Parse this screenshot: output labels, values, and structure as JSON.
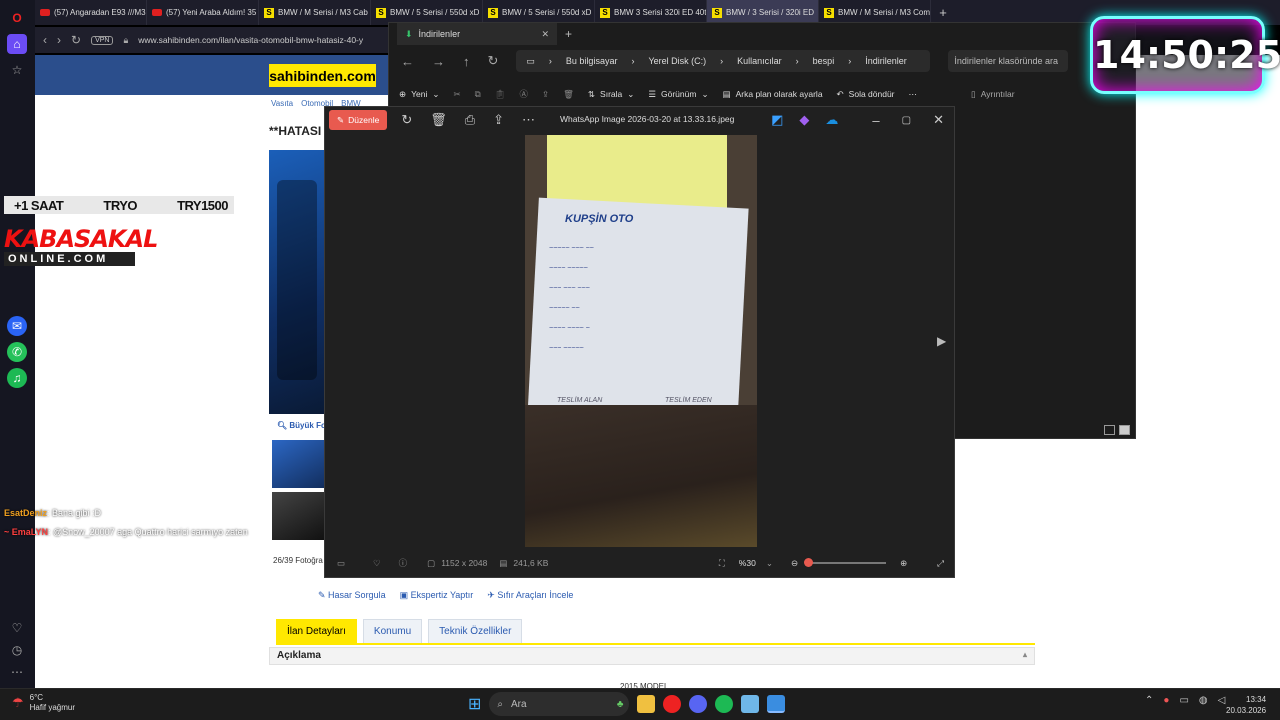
{
  "browser": {
    "tabs": [
      {
        "icon": "youtube-icon",
        "label": "(57) Angaradan E93 ///M3"
      },
      {
        "icon": "youtube-icon",
        "label": "(57) Yeni Araba Aldım! 35"
      },
      {
        "icon": "sahibinden-icon",
        "label": "BMW / M Serisi / M3 Cab"
      },
      {
        "icon": "sahibinden-icon",
        "label": "BMW / 5 Serisi / 550d xD"
      },
      {
        "icon": "sahibinden-icon",
        "label": "BMW / 5 Serisi / 550d xD"
      },
      {
        "icon": "sahibinden-icon",
        "label": "BMW 3 Serisi 320i ED 40th"
      },
      {
        "icon": "sahibinden-icon",
        "label": "BMW / 3 Serisi / 320i ED"
      },
      {
        "icon": "sahibinden-icon",
        "label": "BMW / M Serisi / M3 Com"
      }
    ],
    "new_tab": "+",
    "vpn": "VPN",
    "url": "www.sahibinden.com/ilan/vasita-otomobil-bmw-hatasiz-40-y"
  },
  "site": {
    "logo": "sahibinden.com",
    "breadcrumb": [
      "Vasıta",
      "Otomobil",
      "BMW"
    ],
    "listing_title": "**HATASI",
    "big_photo": "Büyük Fo",
    "photo_count": "26/39 Fotoğra",
    "links": [
      "Hasar Sorgula",
      "Ekspertiz Yaptır",
      "Sıfır Araçları İncele"
    ],
    "tabs": [
      "İlan Detayları",
      "Konumu",
      "Teknik Özellikler"
    ],
    "section": "Açıklama",
    "partial": "2015 MODEL"
  },
  "overlay": {
    "bar": [
      "+1 SAAT",
      "TRYO",
      "TRY1500"
    ],
    "logo_top": "KABASAKAL",
    "logo_bottom": "ONLINE.COM",
    "chat": [
      {
        "user": "EsatDeniz",
        "msg": ": Bana gibi :D",
        "color": "#f0a020"
      },
      {
        "user": "~ EmaLYN",
        "msg": ": @Snow_20007 aga Quattro harici sarmıyo zaten",
        "color": "#ff4040"
      }
    ]
  },
  "explorer": {
    "tab": "İndirilenler",
    "path": [
      "Bu bilgisayar",
      "Yerel Disk (C:)",
      "Kullanıcılar",
      "bespi",
      "İndirilenler"
    ],
    "search": "İndirilenler klasöründe ara",
    "new_label": "Yeni",
    "sort_label": "Sırala",
    "view_label": "Görünüm",
    "bg_label": "Arka plan olarak ayarla",
    "rotate_label": "Sola döndür",
    "details_label": "Ayrıntılar"
  },
  "viewer": {
    "edit": "Düzenle",
    "filename": "WhatsApp Image 2026-03-20 at 13.33.16.jpeg",
    "dimensions": "1152 x 2048",
    "size": "241,6 KB",
    "zoom": "%30",
    "receipt_header": "KUPŞİN OTO",
    "receipt_footer": "TESLİM ALAN",
    "receipt_footer2": "TESLİM EDEN"
  },
  "stream_clock": "14:50:25",
  "taskbar": {
    "temp": "6°C",
    "weather": "Hafif yağmur",
    "search": "Ara",
    "time": "13:34",
    "date": "20.03.2026"
  }
}
